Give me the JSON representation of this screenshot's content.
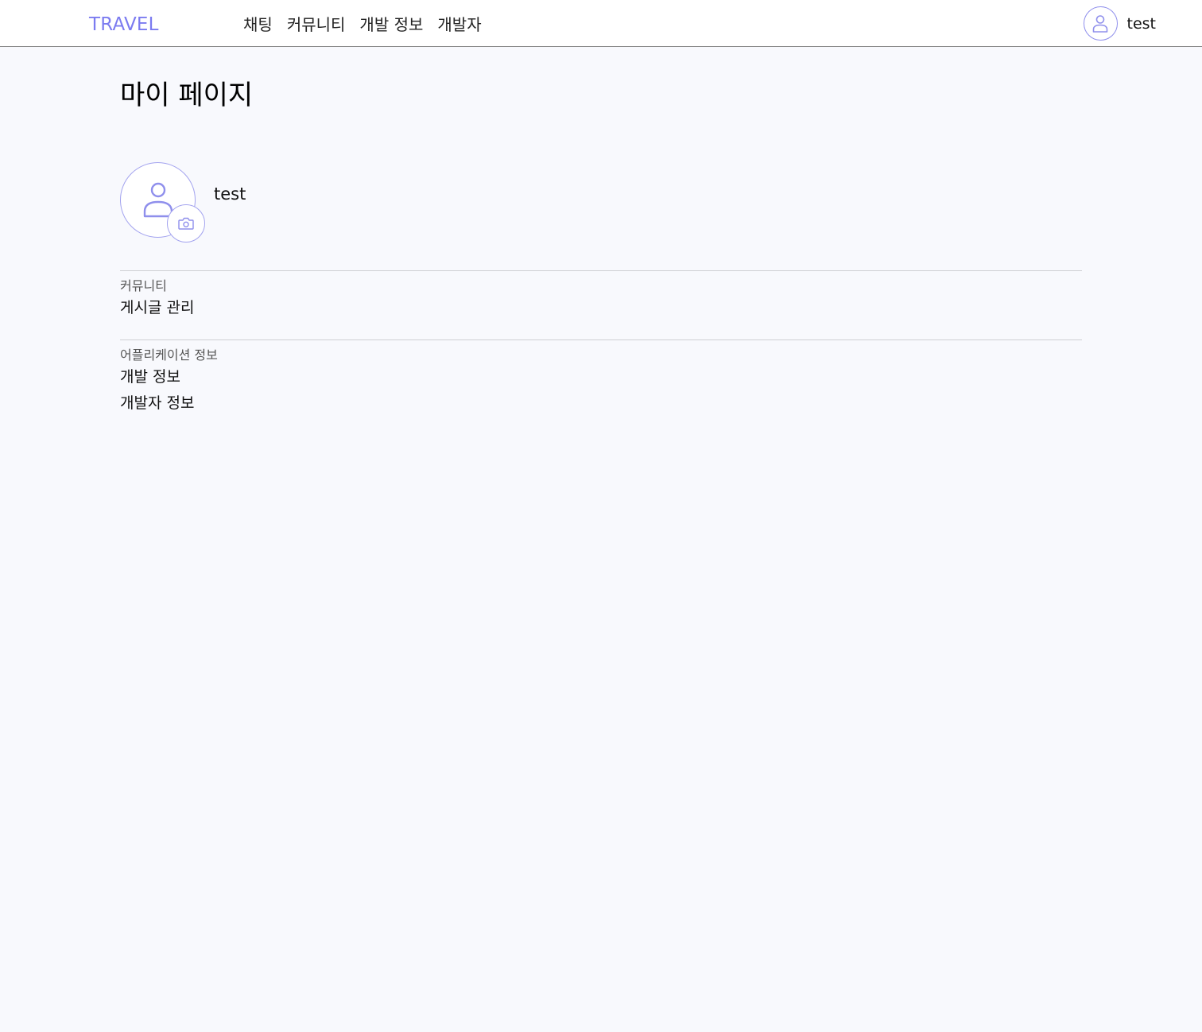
{
  "header": {
    "brand": "TRAVEL",
    "nav": [
      {
        "label": "채팅"
      },
      {
        "label": "커뮤니티"
      },
      {
        "label": "개발 정보"
      },
      {
        "label": "개발자"
      }
    ],
    "user": {
      "name": "test",
      "avatar_icon": "user-icon"
    }
  },
  "page": {
    "title": "마이 페이지"
  },
  "profile": {
    "name": "test",
    "avatar_icon": "user-icon",
    "camera_icon": "camera-icon"
  },
  "sections": [
    {
      "heading": "커뮤니티",
      "items": [
        {
          "label": "게시글 관리"
        }
      ]
    },
    {
      "heading": "어플리케이션 정보",
      "items": [
        {
          "label": "개발 정보"
        },
        {
          "label": "개발자 정보"
        }
      ]
    }
  ],
  "colors": {
    "accent": "#7b7bf0",
    "background": "#f8f9fd",
    "divider": "#cfcfd4"
  }
}
